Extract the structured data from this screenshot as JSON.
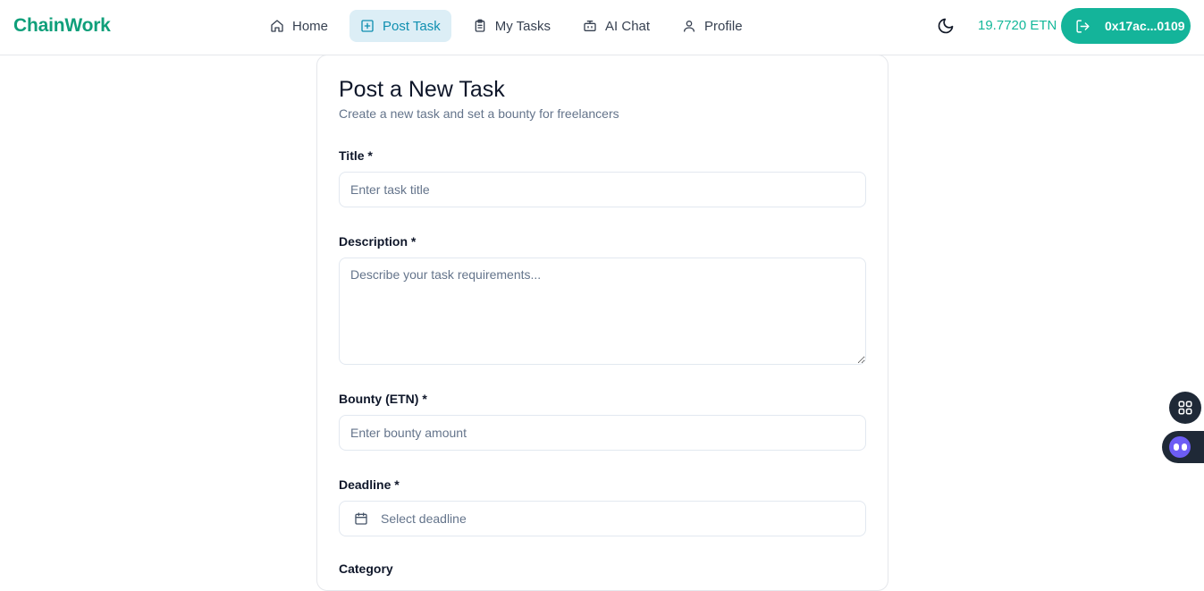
{
  "header": {
    "brand": "ChainWork",
    "nav": [
      {
        "label": "Home",
        "icon": "home-icon",
        "active": false
      },
      {
        "label": "Post Task",
        "icon": "plus-square-icon",
        "active": true
      },
      {
        "label": "My Tasks",
        "icon": "clipboard-icon",
        "active": false
      },
      {
        "label": "AI Chat",
        "icon": "bot-icon",
        "active": false
      },
      {
        "label": "Profile",
        "icon": "user-icon",
        "active": false
      }
    ],
    "balance": "19.7720 ETN",
    "wallet_address": "0x17ac...0109"
  },
  "form": {
    "title": "Post a New Task",
    "subtitle": "Create a new task and set a bounty for freelancers",
    "title_label": "Title *",
    "title_placeholder": "Enter task title",
    "description_label": "Description *",
    "description_placeholder": "Describe your task requirements...",
    "bounty_label": "Bounty (ETN) *",
    "bounty_placeholder": "Enter bounty amount",
    "deadline_label": "Deadline *",
    "deadline_placeholder": "Select deadline",
    "category_label": "Category"
  },
  "colors": {
    "brand": "#0f9f7a",
    "accent": "#14b49a",
    "active_nav_bg": "#dceef6",
    "active_nav_text": "#0f8fb0"
  }
}
